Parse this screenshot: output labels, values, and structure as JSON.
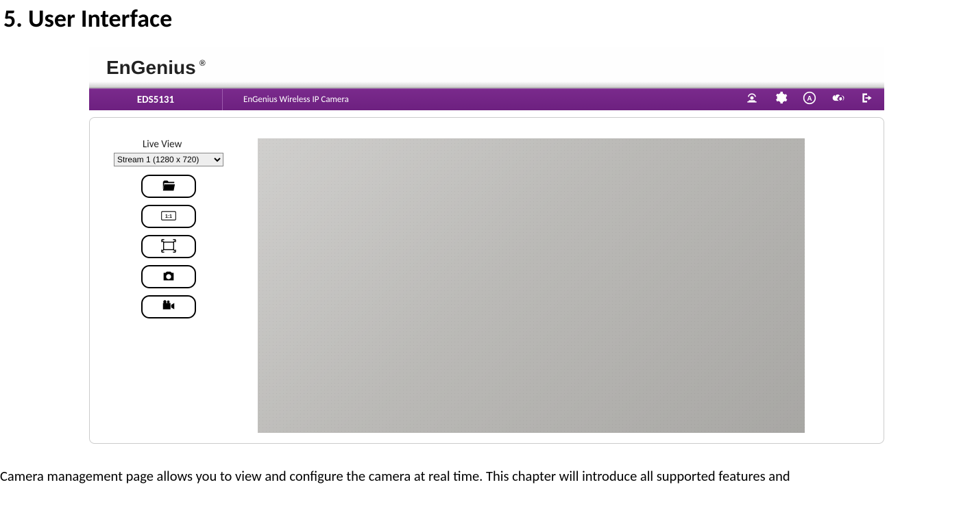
{
  "heading": "5. User Interface",
  "logo": "EnGenius",
  "logo_reg": "®",
  "header": {
    "model": "EDS5131",
    "description": "EnGenius Wireless IP Camera"
  },
  "sidebar": {
    "label": "Live View",
    "stream_selected": "Stream 1 (1280 x 720)"
  },
  "nav_icons": {
    "liveview": "liveview",
    "settings": "settings",
    "auto": "auto",
    "cloud": "cloud-download",
    "logout": "logout"
  },
  "body_text": "Camera management page allows you to view and configure the camera at real time. This chapter will introduce all supported features and"
}
